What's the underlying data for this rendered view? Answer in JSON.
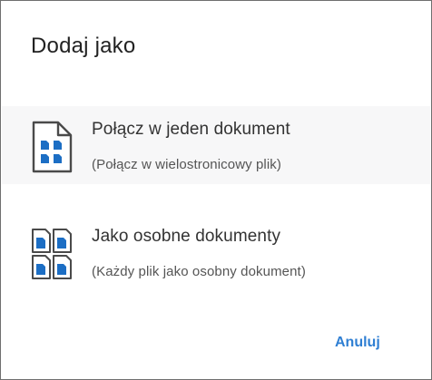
{
  "dialog": {
    "title": "Dodaj jako",
    "options": [
      {
        "title": "Połącz w jeden dokument",
        "subtitle": "(Połącz w wielostronicowy plik)",
        "icon": "single-document-icon"
      },
      {
        "title": "Jako osobne dokumenty",
        "subtitle": "(Każdy plik jako osobny dokument)",
        "icon": "multiple-documents-icon"
      }
    ],
    "cancel_label": "Anuluj"
  },
  "colors": {
    "accent": "#2f7fd3",
    "icon_blue": "#1c6ec4",
    "selected_bg": "#f7f7f8"
  }
}
